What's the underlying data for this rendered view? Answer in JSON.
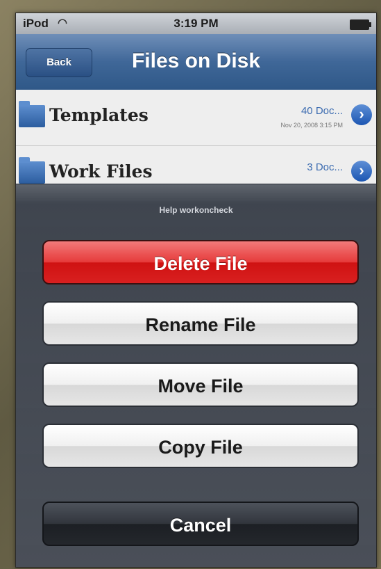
{
  "status_bar": {
    "carrier": "iPod",
    "wifi_icon": "wifi-icon",
    "time": "3:19 PM",
    "battery_icon": "battery-icon"
  },
  "nav_bar": {
    "back_label": "Back",
    "title": "Files on Disk"
  },
  "files": [
    {
      "name": "Templates",
      "size": "40 Doc...",
      "date": "Nov 20, 2008 3:15 PM",
      "icon": "folder-icon"
    },
    {
      "name": "Work Files",
      "size": "3 Doc...",
      "date": "",
      "icon": "folder-icon"
    }
  ],
  "action_sheet": {
    "title": "Help workoncheck",
    "delete_label": "Delete File",
    "rename_label": "Rename File",
    "move_label": "Move File",
    "copy_label": "Copy File",
    "cancel_label": "Cancel"
  },
  "colors": {
    "nav_bar": "#3f6798",
    "destructive": "#e02a2a",
    "sheet_background": "#4a4f58"
  }
}
